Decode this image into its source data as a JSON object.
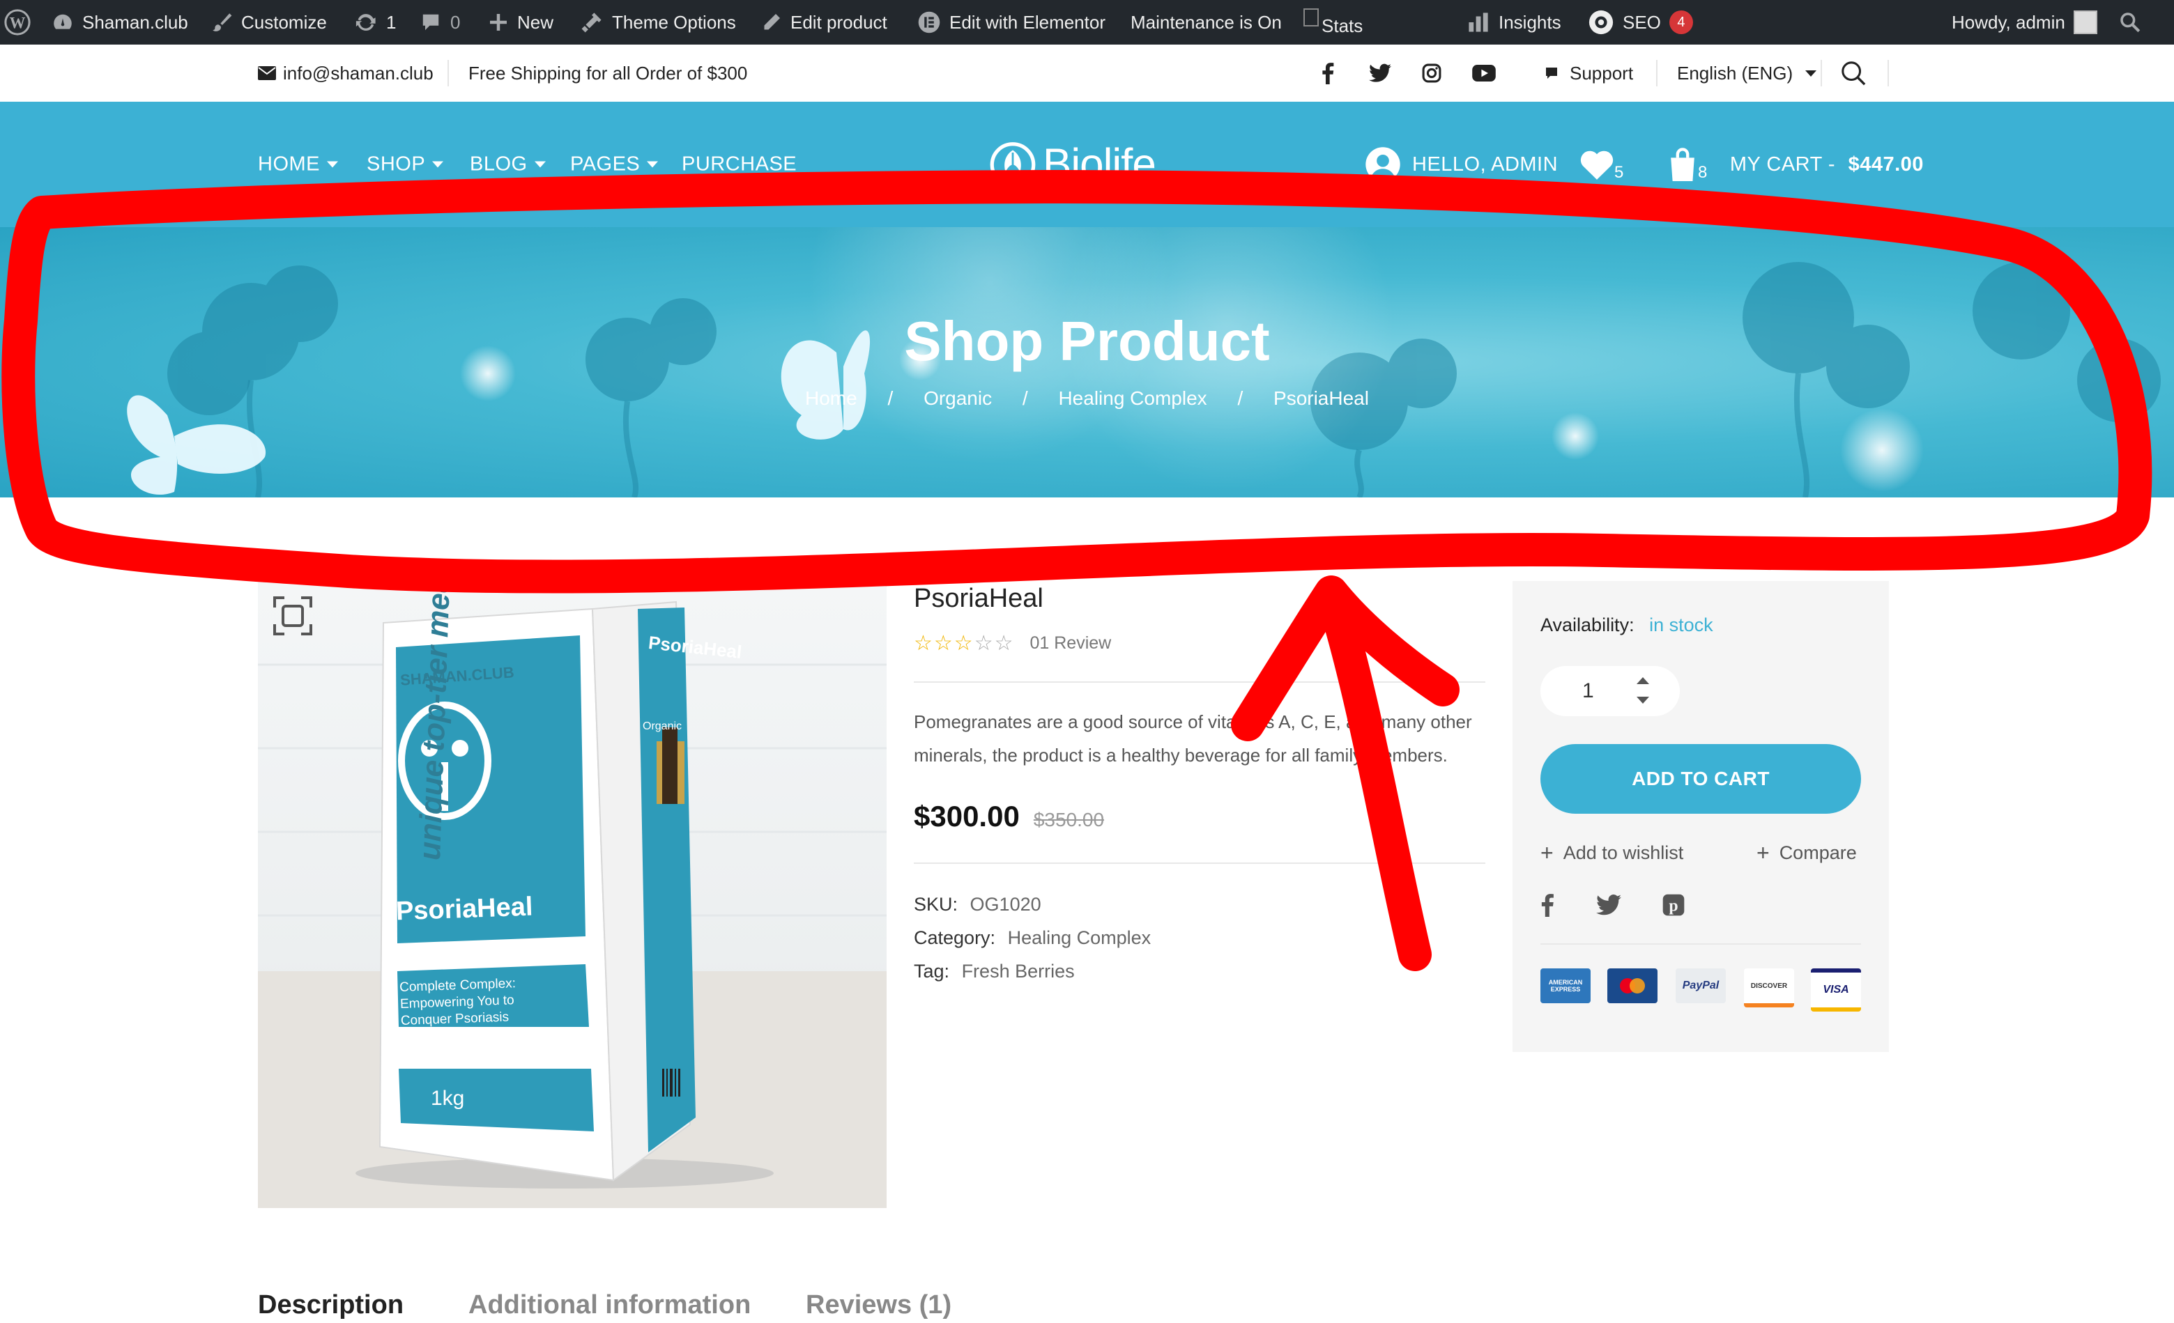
{
  "admin_bar": {
    "site": "Shaman.club",
    "customize": "Customize",
    "updates_count": "1",
    "comments_count": "0",
    "new": "New",
    "theme_options": "Theme Options",
    "edit_product": "Edit product",
    "edit_elementor": "Edit with Elementor",
    "maintenance": "Maintenance is On",
    "stats": "Stats",
    "insights": "Insights",
    "seo": "SEO",
    "seo_count": "4",
    "howdy": "Howdy, admin"
  },
  "top_bar": {
    "email": "info@shaman.club",
    "shipping": "Free Shipping for all Order of $300",
    "support": "Support",
    "language": "English (ENG)"
  },
  "nav": {
    "home": "HOME",
    "shop": "SHOP",
    "blog": "BLOG",
    "pages": "PAGES",
    "purchase": "PURCHASE",
    "logo": "Biolife",
    "hello": "HELLO, ADMIN",
    "wishlist_count": "5",
    "cart_count": "8",
    "cart_label": "MY CART - ",
    "cart_total": "$447.00"
  },
  "banner": {
    "title": "Shop Product",
    "breadcrumb": [
      "Home",
      "Organic",
      "Healing Complex",
      "PsoriaHeal"
    ]
  },
  "product": {
    "name": "PsoriaHeal",
    "review_count": "01 Review",
    "rating": 0,
    "description": "Pomegranates are a good source of vitamins A, C, E, and many other minerals, the product is a healthy beverage for all family members.",
    "price": "$300.00",
    "old_price": "$350.00",
    "sku_label": "SKU:",
    "sku": "OG1020",
    "category_label": "Category:",
    "category": "Healing Complex",
    "tag_label": "Tag:",
    "tag": "Fresh Berries",
    "box": {
      "brand": "SHAMAN.CLUB",
      "name": "PsoriaHeal",
      "tagline": "Complete Complex: Empowering You to Conquer Psoriasis",
      "weight": "1kg",
      "side_text": "unique top-tier medicinal complex",
      "side_small": "Organic"
    }
  },
  "sidebar": {
    "availability_label": "Availability:",
    "availability": "in stock",
    "quantity": "1",
    "add_to_cart": "ADD TO CART",
    "wishlist": "Add to wishlist",
    "compare": "Compare",
    "payments": [
      "AMERICAN EXPRESS",
      "mastercard",
      "PayPal",
      "DISCOVER",
      "VISA"
    ]
  },
  "tabs": [
    "Description",
    "Additional information",
    "Reviews (1)"
  ],
  "colors": {
    "accent": "#3cb1d4",
    "admin_bar": "#23282d",
    "annotation": "#ff0000"
  }
}
